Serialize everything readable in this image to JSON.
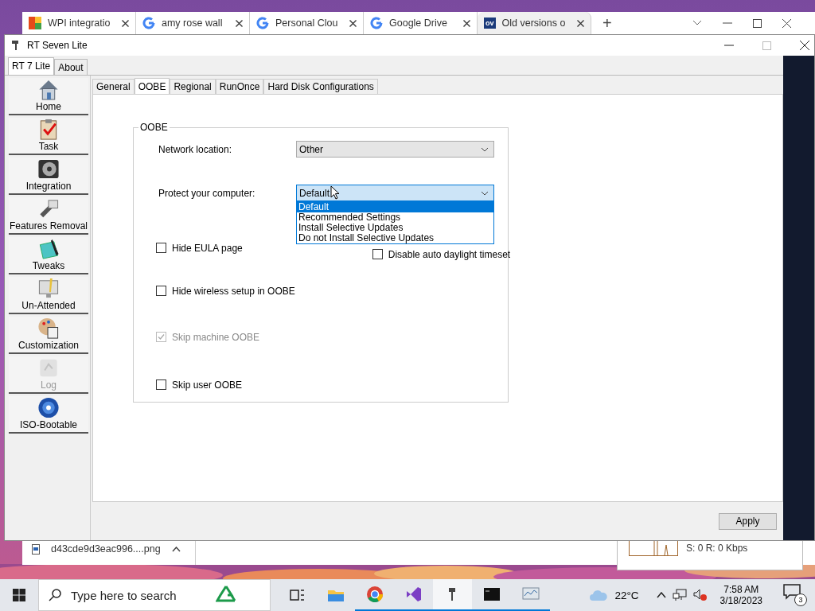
{
  "browser": {
    "tabs": [
      {
        "title": "WPI integratio",
        "kind": "tiles",
        "selected": false
      },
      {
        "title": "amy rose wall",
        "kind": "ring",
        "selected": false
      },
      {
        "title": "Personal Clou",
        "kind": "ring",
        "selected": false
      },
      {
        "title": "Google Drive",
        "kind": "ring",
        "selected": false
      },
      {
        "title": "Old versions o",
        "kind": "badge",
        "badge": "ov",
        "selected": true
      }
    ],
    "new_tab": "+",
    "download": {
      "file": "d43cde9d3eac996....png"
    }
  },
  "network_meter": {
    "reading": "S: 0 R: 0 Kbps"
  },
  "app": {
    "title": "RT Seven Lite",
    "top_tabs": [
      {
        "label": "RT 7 Lite",
        "selected": true
      },
      {
        "label": "About",
        "selected": false
      }
    ],
    "sidebar": [
      {
        "label": "Home",
        "kind": "house",
        "disabled": false
      },
      {
        "label": "Task",
        "kind": "clipboard",
        "disabled": false
      },
      {
        "label": "Integration",
        "kind": "disc",
        "disabled": false
      },
      {
        "label": "Features Removal",
        "kind": "wrench",
        "disabled": false
      },
      {
        "label": "Tweaks",
        "kind": "grid",
        "disabled": false
      },
      {
        "label": "Un-Attended",
        "kind": "monitor",
        "disabled": false
      },
      {
        "label": "Customization",
        "kind": "palette",
        "disabled": false
      },
      {
        "label": "Log",
        "kind": "document",
        "disabled": true
      },
      {
        "label": "ISO-Bootable",
        "kind": "cd",
        "disabled": false
      }
    ],
    "tabs": [
      {
        "label": "General",
        "selected": false
      },
      {
        "label": "OOBE",
        "selected": true
      },
      {
        "label": "Regional",
        "selected": false
      },
      {
        "label": "RunOnce",
        "selected": false
      },
      {
        "label": "Hard Disk Configurations",
        "selected": false
      }
    ],
    "group": {
      "title": "OOBE",
      "network_location": {
        "label": "Network location:",
        "value": "Other"
      },
      "protect": {
        "label": "Protect your computer:",
        "value": "Default",
        "expanded": true,
        "options": [
          {
            "label": "Default",
            "selected": true
          },
          {
            "label": "Recommended Settings",
            "selected": false
          },
          {
            "label": "Install Selective Updates",
            "selected": false
          },
          {
            "label": "Do not Install Selective Updates",
            "selected": false
          }
        ]
      },
      "checkboxes": [
        {
          "label": "Hide EULA page",
          "checked": false,
          "disabled": false
        },
        {
          "label": "Disable auto daylight timeset",
          "checked": false,
          "disabled": false
        },
        {
          "label": "Hide wireless setup in OOBE",
          "checked": false,
          "disabled": false
        },
        {
          "label": "Skip machine OOBE",
          "checked": true,
          "disabled": true
        },
        {
          "label": "Skip user OOBE",
          "checked": false,
          "disabled": false
        }
      ]
    },
    "apply": "Apply"
  },
  "taskbar": {
    "search": {
      "placeholder": "Type here to search"
    },
    "apps": [
      {
        "kind": "taskview",
        "running": false,
        "selected": false
      },
      {
        "kind": "folder",
        "running": false,
        "selected": false
      },
      {
        "kind": "chrome",
        "running": true,
        "selected": false
      },
      {
        "kind": "vs",
        "running": true,
        "selected": false
      },
      {
        "kind": "rt",
        "running": true,
        "selected": true
      },
      {
        "kind": "cmd",
        "running": true,
        "selected": false
      },
      {
        "kind": "monitor",
        "running": true,
        "selected": false
      }
    ],
    "weather": "22°C",
    "time": "7:58 AM",
    "date": "3/18/2023",
    "notifications": "3"
  }
}
